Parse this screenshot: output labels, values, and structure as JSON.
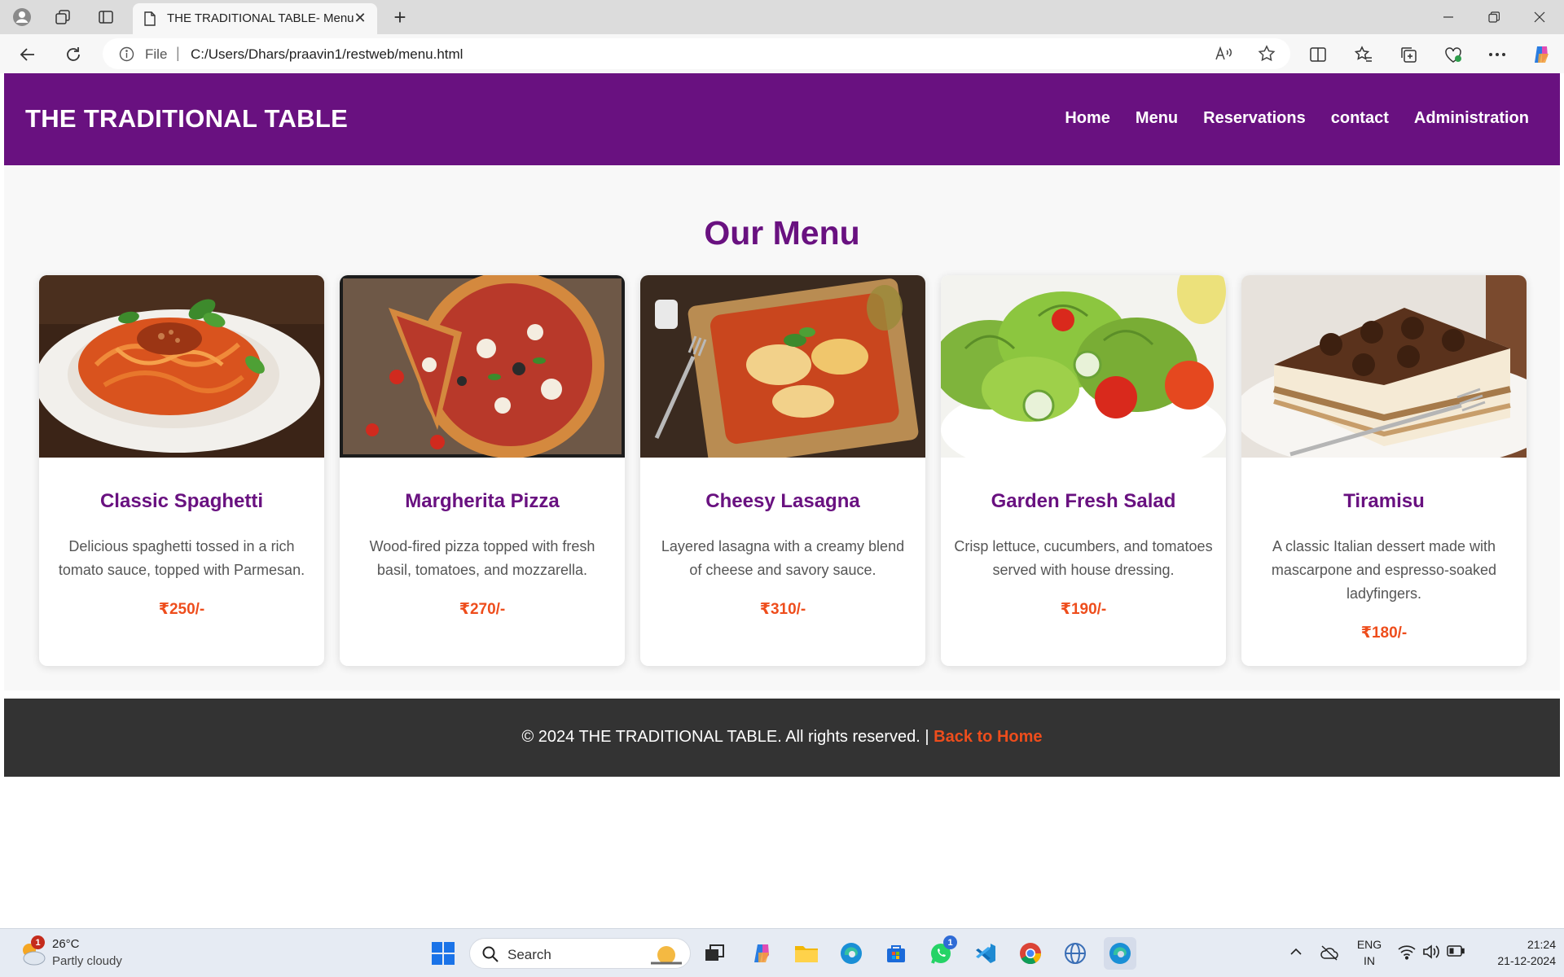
{
  "browser": {
    "tab_title": "THE TRADITIONAL TABLE- Menu",
    "url_scheme_label": "File",
    "url": "C:/Users/Dhars/praavin1/restweb/menu.html"
  },
  "site": {
    "brand": "THE TRADITIONAL TABLE",
    "nav": [
      "Home",
      "Menu",
      "Reservations",
      "contact",
      "Administration"
    ],
    "section_title": "Our Menu",
    "items": [
      {
        "name": "Classic Spaghetti",
        "description": "Delicious spaghetti tossed in a rich tomato sauce, topped with Parmesan.",
        "price": "₹250/-"
      },
      {
        "name": "Margherita Pizza",
        "description": "Wood-fired pizza topped with fresh basil, tomatoes, and mozzarella.",
        "price": "₹270/-"
      },
      {
        "name": "Cheesy Lasagna",
        "description": "Layered lasagna with a creamy blend of cheese and savory sauce.",
        "price": "₹310/-"
      },
      {
        "name": "Garden Fresh Salad",
        "description": "Crisp lettuce, cucumbers, and tomatoes served with house dressing.",
        "price": "₹190/-"
      },
      {
        "name": "Tiramisu",
        "description": "A classic Italian dessert made with mascarpone and espresso-soaked ladyfingers.",
        "price": "₹180/-"
      }
    ],
    "footer_text": "© 2024 THE TRADITIONAL TABLE. All rights reserved. |",
    "footer_link": "Back to Home"
  },
  "taskbar": {
    "weather_temp": "26°C",
    "weather_condition": "Partly cloudy",
    "weather_badge": "1",
    "search_label": "Search",
    "whatsapp_badge": "1",
    "lang": "ENG",
    "region": "IN",
    "time": "21:24",
    "date": "21-12-2024"
  },
  "colors": {
    "brand_purple": "#691180",
    "price_orange": "#ee4d1c",
    "footer_bg": "#333333"
  }
}
